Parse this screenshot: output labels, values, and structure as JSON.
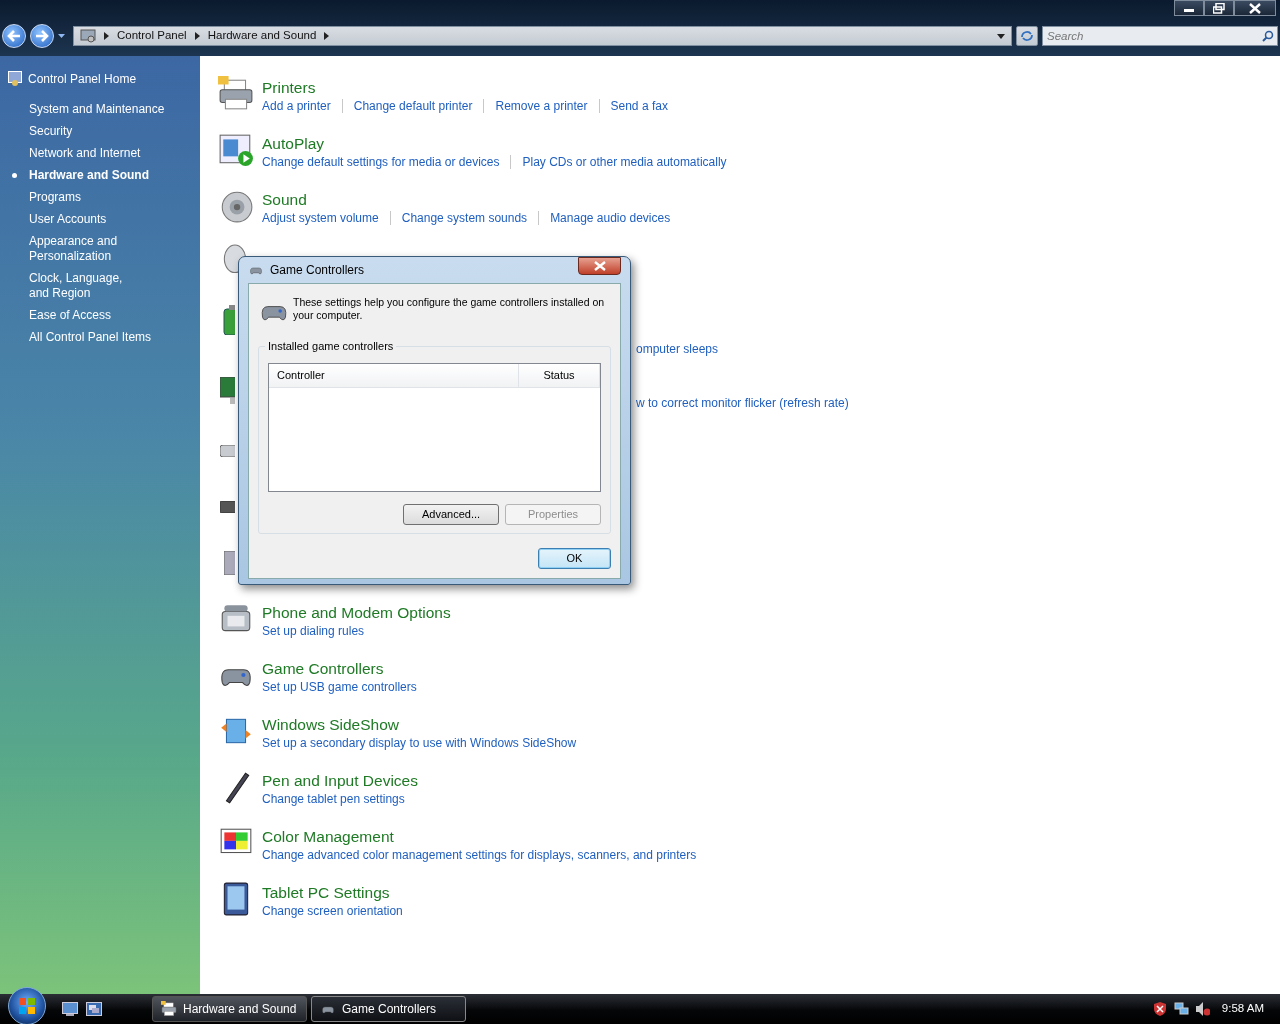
{
  "address_bar": {
    "crumbs": [
      "Control Panel",
      "Hardware and Sound"
    ]
  },
  "search": {
    "placeholder": "Search"
  },
  "sidebar": {
    "home": "Control Panel Home",
    "items": [
      {
        "label": "System and Maintenance",
        "selected": false
      },
      {
        "label": "Security",
        "selected": false
      },
      {
        "label": "Network and Internet",
        "selected": false
      },
      {
        "label": "Hardware and Sound",
        "selected": true
      },
      {
        "label": "Programs",
        "selected": false
      },
      {
        "label": "User Accounts",
        "selected": false
      },
      {
        "label": "Appearance and Personalization",
        "selected": false
      },
      {
        "label": "Clock, Language, and Region",
        "selected": false
      },
      {
        "label": "Ease of Access",
        "selected": false
      },
      {
        "label": "All Control Panel Items",
        "selected": false
      }
    ]
  },
  "categories": [
    {
      "kind": "full",
      "title": "Printers",
      "links": [
        "Add a printer",
        "Change default printer",
        "Remove a printer",
        "Send a fax"
      ]
    },
    {
      "kind": "full",
      "title": "AutoPlay",
      "links": [
        "Change default settings for media or devices",
        "Play CDs or other media automatically"
      ]
    },
    {
      "kind": "full",
      "title": "Sound",
      "links": [
        "Adjust system volume",
        "Change system sounds",
        "Manage audio devices"
      ]
    },
    {
      "kind": "covered"
    },
    {
      "kind": "covered",
      "link_fragment": "omputer sleeps"
    },
    {
      "kind": "covered",
      "link_fragment": "w to correct monitor flicker (refresh rate)"
    },
    {
      "kind": "covered"
    },
    {
      "kind": "covered"
    },
    {
      "kind": "covered"
    },
    {
      "kind": "full",
      "title": "Phone and Modem Options",
      "links": [
        "Set up dialing rules"
      ]
    },
    {
      "kind": "full",
      "title": "Game Controllers",
      "links": [
        "Set up USB game controllers"
      ]
    },
    {
      "kind": "full",
      "title": "Windows SideShow",
      "links": [
        "Set up a secondary display to use with Windows SideShow"
      ]
    },
    {
      "kind": "full",
      "title": "Pen and Input Devices",
      "links": [
        "Change tablet pen settings"
      ]
    },
    {
      "kind": "full",
      "title": "Color Management",
      "links": [
        "Change advanced color management settings for displays, scanners, and printers"
      ]
    },
    {
      "kind": "full",
      "title": "Tablet PC Settings",
      "links": [
        "Change screen orientation"
      ]
    }
  ],
  "dialog": {
    "title": "Game Controllers",
    "description": "These settings help you configure the game controllers installed on your computer.",
    "group_label": "Installed game controllers",
    "columns": [
      "Controller",
      "Status"
    ],
    "buttons": [
      {
        "label": "Advanced...",
        "disabled": false
      },
      {
        "label": "Properties",
        "disabled": true
      }
    ],
    "ok": "OK"
  },
  "taskbar": {
    "tasks": [
      {
        "label": "Hardware and Sound",
        "selected": false
      },
      {
        "label": "Game Controllers",
        "selected": true
      }
    ],
    "clock": "9:58 AM"
  }
}
